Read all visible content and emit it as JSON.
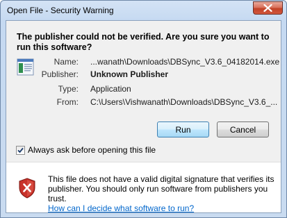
{
  "window": {
    "title": "Open File - Security Warning"
  },
  "dialog": {
    "heading": "The publisher could not be verified.  Are you sure you want to run this software?",
    "fields": [
      {
        "label": "Name:",
        "value": "...wanath\\Downloads\\DBSync_V3.6_04182014.exe"
      },
      {
        "label": "Publisher:",
        "value": "Unknown Publisher"
      },
      {
        "label": "Type:",
        "value": "Application"
      },
      {
        "label": "From:",
        "value": "C:\\Users\\Vishwanath\\Downloads\\DBSync_V3.6_..."
      }
    ],
    "run_label": "Run",
    "cancel_label": "Cancel",
    "checkbox_label": "Always ask before opening this file",
    "checkbox_checked": true
  },
  "warning": {
    "text": "This file does not have a valid digital signature that verifies its publisher.  You should only run software from publishers you trust.",
    "link_text": "How can I decide what software to run?"
  },
  "icons": {
    "file": "application-file-icon",
    "warning": "security-warning-shield-icon",
    "close": "close-icon"
  },
  "colors": {
    "link": "#0066cc",
    "close_button": "#c24227",
    "frame": "#c5d9f1"
  }
}
